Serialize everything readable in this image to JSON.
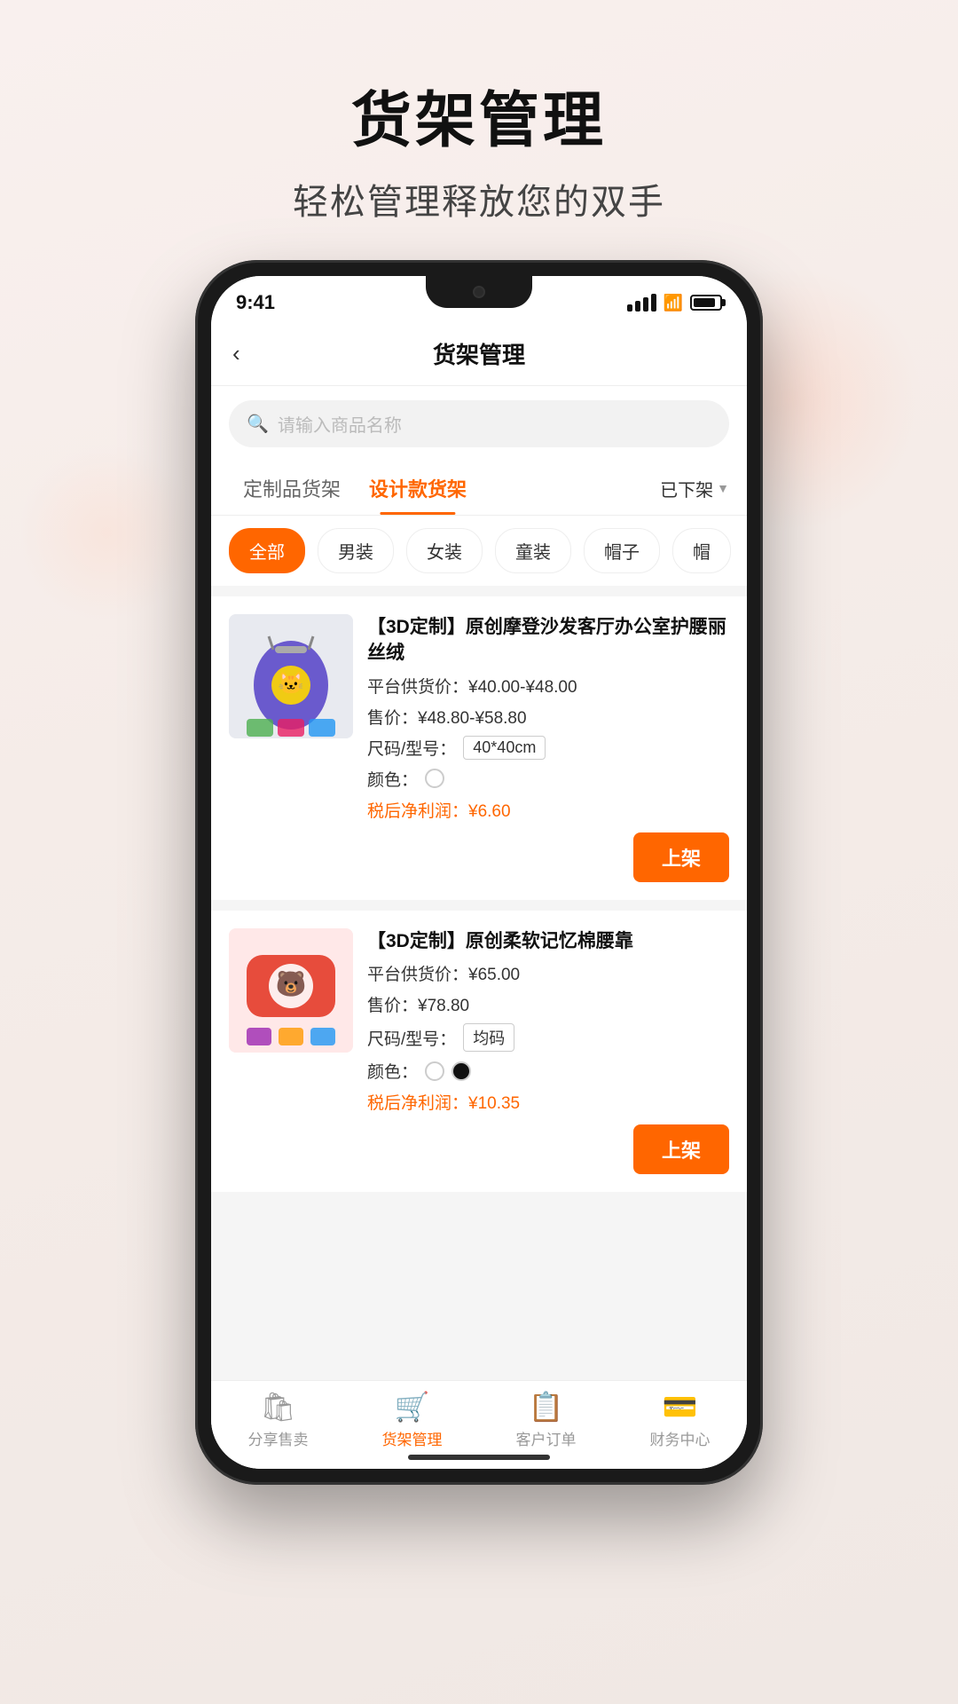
{
  "page": {
    "title_main": "货架管理",
    "title_sub": "轻松管理释放您的双手"
  },
  "status_bar": {
    "time": "9:41"
  },
  "nav": {
    "back_icon": "‹",
    "title": "货架管理"
  },
  "search": {
    "placeholder": "请输入商品名称"
  },
  "tabs": [
    {
      "label": "定制品货架",
      "active": false
    },
    {
      "label": "设计款货架",
      "active": true
    }
  ],
  "status_filter": {
    "label": "已下架",
    "arrow": "▼"
  },
  "categories": [
    {
      "label": "全部",
      "active": true
    },
    {
      "label": "男装",
      "active": false
    },
    {
      "label": "女装",
      "active": false
    },
    {
      "label": "童装",
      "active": false
    },
    {
      "label": "帽子",
      "active": false
    },
    {
      "label": "帽",
      "active": false
    }
  ],
  "products": [
    {
      "name": "【3D定制】原创摩登沙发客厅办公室护腰丽丝绒",
      "platform_price": "平台供货价：¥40.00-¥48.00",
      "sell_price": "售价：¥48.80-¥58.80",
      "size_label": "尺码/型号：",
      "size_value": "40*40cm",
      "color_label": "颜色：",
      "colors": [
        "white"
      ],
      "profit": "税后净利润：¥6.60",
      "btn_label": "上架",
      "image_type": "bag"
    },
    {
      "name": "【3D定制】原创柔软记忆棉腰靠",
      "platform_price": "平台供货价：¥65.00",
      "sell_price": "售价：¥78.80",
      "size_label": "尺码/型号：",
      "size_value": "均码",
      "color_label": "颜色：",
      "colors": [
        "white",
        "black"
      ],
      "profit": "税后净利润：¥10.35",
      "btn_label": "上架",
      "image_type": "pillow"
    }
  ],
  "bottom_tabs": [
    {
      "label": "分享售卖",
      "icon": "🛍",
      "active": false
    },
    {
      "label": "货架管理",
      "icon": "🛒",
      "active": true
    },
    {
      "label": "客户订单",
      "icon": "📋",
      "active": false
    },
    {
      "label": "财务中心",
      "icon": "💳",
      "active": false
    }
  ]
}
